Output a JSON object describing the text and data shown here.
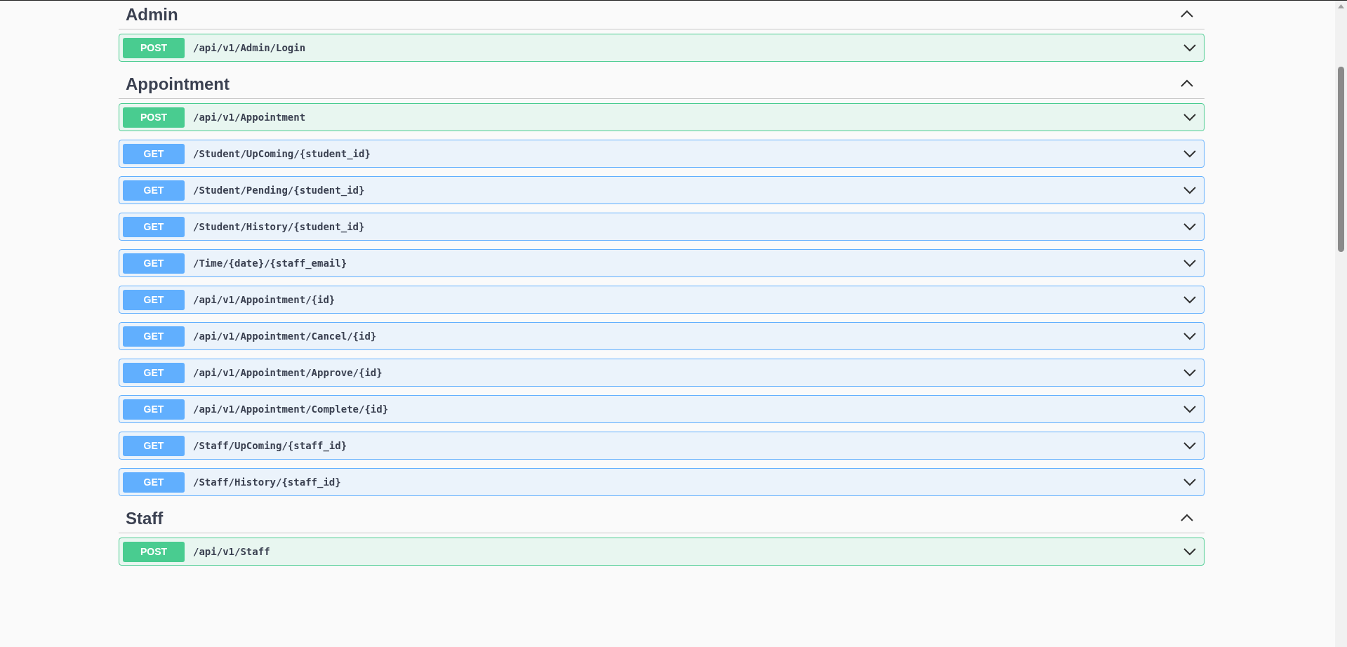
{
  "sections": [
    {
      "title": "Admin",
      "expanded": true,
      "operations": [
        {
          "kind": "post",
          "method": "POST",
          "path": "/api/v1/Admin/Login",
          "expanded": false
        }
      ]
    },
    {
      "title": "Appointment",
      "expanded": true,
      "operations": [
        {
          "kind": "post",
          "method": "POST",
          "path": "/api/v1/Appointment",
          "expanded": false
        },
        {
          "kind": "get",
          "method": "GET",
          "path": "/Student/UpComing/{student_id}",
          "expanded": false
        },
        {
          "kind": "get",
          "method": "GET",
          "path": "/Student/Pending/{student_id}",
          "expanded": false
        },
        {
          "kind": "get",
          "method": "GET",
          "path": "/Student/History/{student_id}",
          "expanded": false
        },
        {
          "kind": "get",
          "method": "GET",
          "path": "/Time/{date}/{staff_email}",
          "expanded": false
        },
        {
          "kind": "get",
          "method": "GET",
          "path": "/api/v1/Appointment/{id}",
          "expanded": false
        },
        {
          "kind": "get",
          "method": "GET",
          "path": "/api/v1/Appointment/Cancel/{id}",
          "expanded": false
        },
        {
          "kind": "get",
          "method": "GET",
          "path": "/api/v1/Appointment/Approve/{id}",
          "expanded": false
        },
        {
          "kind": "get",
          "method": "GET",
          "path": "/api/v1/Appointment/Complete/{id}",
          "expanded": false
        },
        {
          "kind": "get",
          "method": "GET",
          "path": "/Staff/UpComing/{staff_id}",
          "expanded": false
        },
        {
          "kind": "get",
          "method": "GET",
          "path": "/Staff/History/{staff_id}",
          "expanded": false
        }
      ]
    },
    {
      "title": "Staff",
      "expanded": true,
      "operations": [
        {
          "kind": "post",
          "method": "POST",
          "path": "/api/v1/Staff",
          "expanded": false
        }
      ]
    }
  ]
}
